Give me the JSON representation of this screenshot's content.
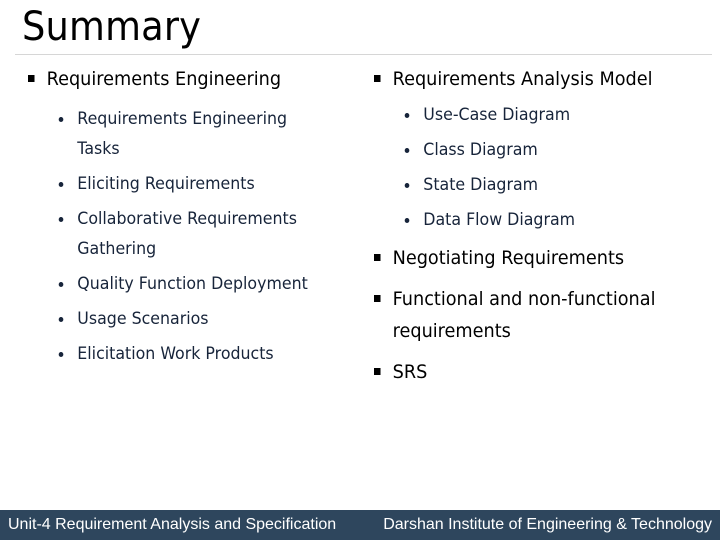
{
  "slide": {
    "title": "Summary"
  },
  "left_column": {
    "heading": "Requirements Engineering",
    "items": [
      {
        "line1": "Requirements Engineering",
        "line2": "Tasks"
      },
      {
        "line1": "Eliciting Requirements",
        "line2": ""
      },
      {
        "line1": "Collaborative Requirements",
        "line2": "Gathering"
      },
      {
        "line1": "Quality Function Deployment",
        "line2": ""
      },
      {
        "line1": "Usage Scenarios",
        "line2": ""
      },
      {
        "line1": "Elicitation Work Products",
        "line2": ""
      }
    ]
  },
  "right_column": {
    "heading": "Requirements Analysis Model",
    "items": [
      "Use-Case Diagram",
      "Class Diagram",
      "State Diagram",
      "Data Flow Diagram"
    ],
    "more_headings": [
      {
        "line1": "Negotiating Requirements",
        "line2": ""
      },
      {
        "line1": "Functional and non-functional",
        "line2": "requirements"
      },
      {
        "line1": "SRS",
        "line2": ""
      }
    ]
  },
  "footer": {
    "left": "Unit-4 Requirement Analysis and Specification",
    "right": "Darshan Institute of Engineering & Technology",
    "background_color": "#2e465d"
  }
}
